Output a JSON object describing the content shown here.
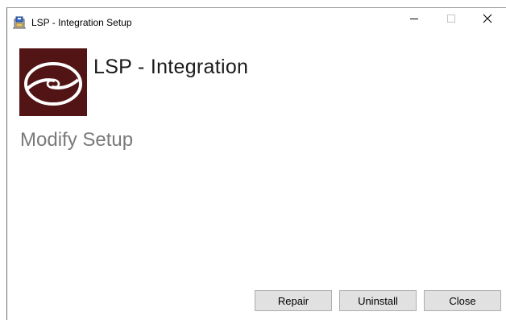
{
  "window": {
    "title": "LSP - Integration Setup"
  },
  "icons": {
    "app": "installer-icon",
    "minimize": "minimize-icon",
    "maximize": "maximize-icon",
    "close": "close-icon",
    "logo": "disc-logo-icon"
  },
  "header": {
    "product_title": "LSP - Integration"
  },
  "page": {
    "heading": "Modify Setup"
  },
  "buttons": {
    "repair": "Repair",
    "uninstall": "Uninstall",
    "close": "Close"
  },
  "colors": {
    "logo_background": "#1a0303",
    "logo_dots": "#5a1616",
    "heading_gray": "#7a7a7a",
    "button_face": "#e1e1e1",
    "button_border": "#adadad"
  }
}
